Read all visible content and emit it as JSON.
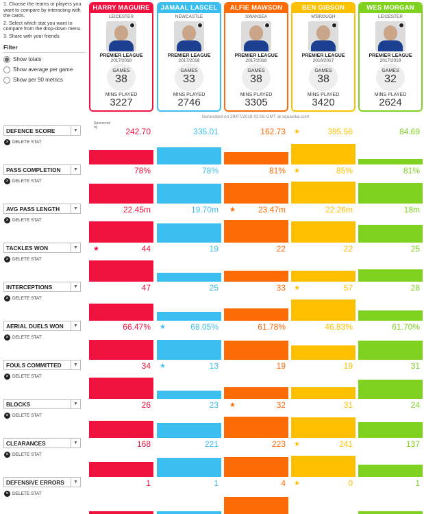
{
  "sidebar": {
    "instructions": [
      "1. Choose the teams or players you want to compare by interacting with the cards.",
      "2. Select which stat you want to compare from the drop-down menu.",
      "3. Share with your friends."
    ],
    "filter_title": "Filter",
    "options": [
      {
        "label": "Show totals",
        "selected": true
      },
      {
        "label": "Show average per game",
        "selected": false
      },
      {
        "label": "Show per 90 metrics",
        "selected": false
      }
    ]
  },
  "players": [
    {
      "name": "HARRY MAGUIRE",
      "club": "LEICESTER",
      "league": "PREMIER LEAGUE",
      "season": "2017/2018",
      "games_label": "GAMES",
      "games": "38",
      "mins_label": "MINS PLAYED",
      "mins": "3227",
      "color": "#f0123f"
    },
    {
      "name": "JAMAAL LASCEL",
      "club": "NEWCASTLE",
      "league": "PREMIER LEAGUE",
      "season": "2017/2018",
      "games_label": "GAMES",
      "games": "33",
      "mins_label": "MINS PLAYED",
      "mins": "2746",
      "color": "#3cbff0"
    },
    {
      "name": "ALFIE MAWSON",
      "club": "SWANSEA",
      "league": "PREMIER LEAGUE",
      "season": "2017/2018",
      "games_label": "GAMES",
      "games": "38",
      "mins_label": "MINS PLAYED",
      "mins": "3305",
      "color": "#fd6b07"
    },
    {
      "name": "BEN GIBSON",
      "club": "M'BROUGH",
      "league": "PREMIER LEAGUE",
      "season": "2016/2017",
      "games_label": "GAMES",
      "games": "38",
      "mins_label": "MINS PLAYED",
      "mins": "3420",
      "color": "#fdc000"
    },
    {
      "name": "WES MORGAN",
      "club": "LEICESTER",
      "league": "PREMIER LEAGUE",
      "season": "2017/2018",
      "games_label": "GAMES",
      "games": "32",
      "mins_label": "MINS PLAYED",
      "mins": "2624",
      "color": "#7fd320"
    }
  ],
  "generated": "Generated on 29/07/2018 02:06 GMT at squawka.com",
  "sponsored": "Sponsored by",
  "delete_label": "DELETE STAT",
  "stats": [
    {
      "name": "DEFENCE SCORE",
      "values": [
        "242.70",
        "335.01",
        "162.73",
        "395.56",
        "84.69"
      ],
      "levels": [
        0.42,
        0.5,
        0.35,
        0.6,
        0.15
      ],
      "star": 3
    },
    {
      "name": "PASS COMPLETION",
      "values": [
        "78%",
        "78%",
        "81%",
        "85%",
        "81%"
      ],
      "levels": [
        0.58,
        0.58,
        0.6,
        0.64,
        0.6
      ],
      "star": 3
    },
    {
      "name": "AVG PASS LENGTH",
      "values": [
        "22.45m",
        "19.70m",
        "23.47m",
        "22.26m",
        "18m"
      ],
      "levels": [
        0.62,
        0.56,
        0.66,
        0.62,
        0.52
      ],
      "star": 2
    },
    {
      "name": "TACKLES WON",
      "values": [
        "44",
        "19",
        "22",
        "22",
        "25"
      ],
      "levels": [
        0.62,
        0.26,
        0.32,
        0.32,
        0.36
      ],
      "star": 0
    },
    {
      "name": "INTERCEPTIONS",
      "values": [
        "47",
        "25",
        "33",
        "57",
        "28"
      ],
      "levels": [
        0.5,
        0.26,
        0.36,
        0.62,
        0.3
      ],
      "star": 3
    },
    {
      "name": "AERIAL DUELS WON",
      "values": [
        "66.47%",
        "68.05%",
        "61.78%",
        "46.83%",
        "61.70%"
      ],
      "levels": [
        0.58,
        0.58,
        0.55,
        0.42,
        0.55
      ],
      "star": 1
    },
    {
      "name": "FOULS COMMITTED",
      "values": [
        "34",
        "13",
        "19",
        "19",
        "31"
      ],
      "levels": [
        0.62,
        0.24,
        0.34,
        0.34,
        0.56
      ],
      "star": 1
    },
    {
      "name": "BLOCKS",
      "values": [
        "26",
        "23",
        "32",
        "31",
        "24"
      ],
      "levels": [
        0.5,
        0.44,
        0.62,
        0.6,
        0.46
      ],
      "star": 2
    },
    {
      "name": "CLEARANCES",
      "values": [
        "168",
        "221",
        "223",
        "241",
        "137"
      ],
      "levels": [
        0.44,
        0.56,
        0.58,
        0.62,
        0.35
      ],
      "star": 3
    },
    {
      "name": "DEFENSIVE ERRORS",
      "values": [
        "1",
        "1",
        "4",
        "0",
        "1"
      ],
      "levels": [
        0.14,
        0.14,
        0.56,
        0.0,
        0.14
      ],
      "star": 3
    }
  ]
}
